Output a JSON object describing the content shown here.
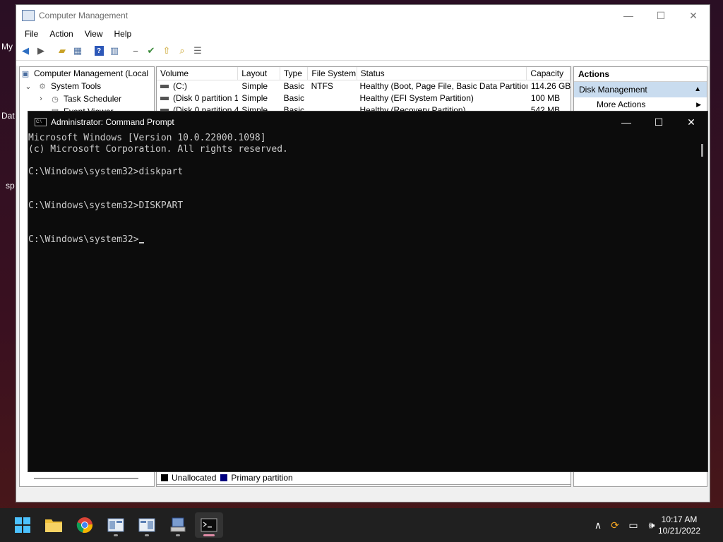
{
  "desktop": {
    "labels": [
      "My",
      "Dat",
      "sp"
    ]
  },
  "computer_management": {
    "title": "Computer Management",
    "menu": [
      "File",
      "Action",
      "View",
      "Help"
    ],
    "tree": {
      "root": "Computer Management (Local",
      "system_tools": "System Tools",
      "task_scheduler": "Task Scheduler",
      "event_viewer": "Event Viewer"
    },
    "list": {
      "columns": [
        "Volume",
        "Layout",
        "Type",
        "File System",
        "Status",
        "Capacity"
      ],
      "rows": [
        [
          "(C:)",
          "Simple",
          "Basic",
          "NTFS",
          "Healthy (Boot, Page File, Basic Data Partition)",
          "114.26 GB"
        ],
        [
          "(Disk 0 partition 1)",
          "Simple",
          "Basic",
          "",
          "Healthy (EFI System Partition)",
          "100 MB"
        ],
        [
          "(Disk 0 partition 4)",
          "Simple",
          "Basic",
          "",
          "Healthy (Recovery Partition)",
          "542 MB"
        ]
      ]
    },
    "legend": {
      "unallocated": "Unallocated",
      "primary": "Primary partition",
      "unallocated_color": "#000000",
      "primary_color": "#00007f"
    },
    "actions": {
      "header": "Actions",
      "selected": "Disk Management",
      "more": "More Actions"
    }
  },
  "cmd": {
    "title": "Administrator: Command Prompt",
    "lines": [
      "Microsoft Windows [Version 10.0.22000.1098]",
      "(c) Microsoft Corporation. All rights reserved.",
      "",
      "C:\\Windows\\system32>diskpart",
      "",
      "",
      "C:\\Windows\\system32>DISKPART",
      "",
      "",
      "C:\\Windows\\system32>"
    ]
  },
  "taskbar": {
    "apps": [
      "start-icon",
      "file-explorer-icon",
      "chrome-icon",
      "computer-management-icon",
      "event-viewer-icon",
      "device-manager-icon",
      "command-prompt-icon"
    ],
    "time": "10:17 AM",
    "date": "10/21/2022"
  }
}
